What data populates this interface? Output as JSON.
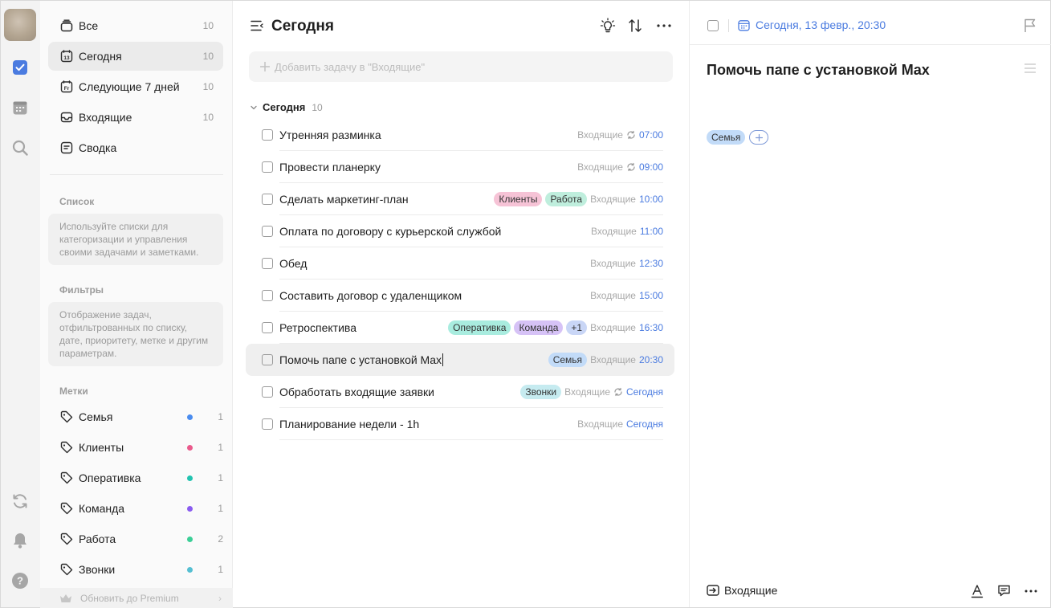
{
  "sidebar": {
    "nav": [
      {
        "label": "Все",
        "count": "10",
        "icon": "all-icon"
      },
      {
        "label": "Сегодня",
        "count": "10",
        "icon": "calendar-today-icon",
        "day": "13"
      },
      {
        "label": "Следующие 7 дней",
        "count": "10",
        "icon": "calendar-week-icon",
        "day": "Fr"
      },
      {
        "label": "Входящие",
        "count": "10",
        "icon": "inbox-icon"
      },
      {
        "label": "Сводка",
        "count": "",
        "icon": "summary-icon"
      }
    ],
    "lists_title": "Список",
    "lists_hint": "Используйте списки для категоризации и управления своими задачами и заметками.",
    "filters_title": "Фильтры",
    "filters_hint": "Отображение задач, отфильтрованных по списку, дате, приоритету, метке и другим параметрам.",
    "tags_title": "Метки",
    "tags": [
      {
        "label": "Семья",
        "count": "1",
        "color": "#4a8cef"
      },
      {
        "label": "Клиенты",
        "count": "1",
        "color": "#ea5a8c"
      },
      {
        "label": "Оперативка",
        "count": "1",
        "color": "#22c3b0"
      },
      {
        "label": "Команда",
        "count": "1",
        "color": "#8a5cf0"
      },
      {
        "label": "Работа",
        "count": "2",
        "color": "#3bcf97"
      },
      {
        "label": "Звонки",
        "count": "1",
        "color": "#55bfd2"
      }
    ],
    "premium_label": "Обновить до Premium"
  },
  "main": {
    "title": "Сегодня",
    "add_placeholder": "Добавить задачу в \"Входящие\"",
    "group": {
      "label": "Сегодня",
      "count": "10"
    },
    "tasks": [
      {
        "title": "Утренняя разминка",
        "tags": [],
        "project": "Входящие",
        "repeat": true,
        "time": "07:00"
      },
      {
        "title": "Провести планерку",
        "tags": [],
        "project": "Входящие",
        "repeat": true,
        "time": "09:00"
      },
      {
        "title": "Сделать маркетинг-план",
        "tags": [
          {
            "label": "Клиенты",
            "bg": "#f6c3d6"
          },
          {
            "label": "Работа",
            "bg": "#bfeedd"
          }
        ],
        "project": "Входящие",
        "repeat": false,
        "time": "10:00"
      },
      {
        "title": "Оплата по договору с курьерской службой",
        "tags": [],
        "project": "Входящие",
        "repeat": false,
        "time": "11:00"
      },
      {
        "title": "Обед",
        "tags": [],
        "project": "Входящие",
        "repeat": false,
        "time": "12:30"
      },
      {
        "title": "Составить договор с удаленщиком",
        "tags": [],
        "project": "Входящие",
        "repeat": false,
        "time": "15:00"
      },
      {
        "title": "Ретроспектива",
        "tags": [
          {
            "label": "Оперативка",
            "bg": "#a9ecdf"
          },
          {
            "label": "Команда",
            "bg": "#d6c2f6"
          },
          {
            "label": "+1",
            "bg": "#c9d6f6"
          }
        ],
        "project": "Входящие",
        "repeat": false,
        "time": "16:30"
      },
      {
        "title": "Помочь папе с установкой Max",
        "tags": [
          {
            "label": "Семья",
            "bg": "#c2dbf8"
          }
        ],
        "project": "Входящие",
        "repeat": false,
        "time": "20:30",
        "selected": true
      },
      {
        "title": "Обработать входящие заявки",
        "tags": [
          {
            "label": "Звонки",
            "bg": "#c6ebf0"
          }
        ],
        "project": "Входящие",
        "repeat": true,
        "time": "Сегодня"
      },
      {
        "title": "Планирование недели - 1h",
        "tags": [],
        "project": "Входящие",
        "repeat": false,
        "time": "Сегодня"
      }
    ]
  },
  "detail": {
    "date_label": "Сегодня, 13 февр., 20:30",
    "title": "Помочь папе с установкой Max",
    "tag": "Семья",
    "project": "Входящие"
  },
  "colors": {
    "accent": "#4a7be0",
    "tag_family": "#c2dbf8"
  }
}
